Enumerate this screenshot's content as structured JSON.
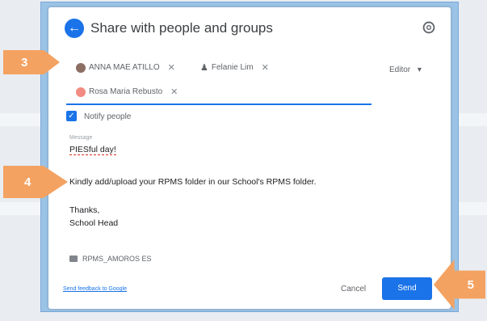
{
  "dialog": {
    "title": "Share with people and groups",
    "back_icon": "arrow-left-icon",
    "settings_icon": "gear-icon"
  },
  "recipients": [
    {
      "name": "ANNA MAE ATILLO",
      "avatar_color": "#8d6e63"
    },
    {
      "name": "Felanie Lim",
      "avatar_color": "#5f6368"
    },
    {
      "name": "Rosa Maria Rebusto",
      "avatar_color": "#f28b82"
    }
  ],
  "role": {
    "label": "Editor",
    "dropdown_icon": "chevron-down-icon"
  },
  "notify": {
    "label": "Notify people",
    "checked": true
  },
  "message": {
    "label": "Message",
    "lines": [
      "PIESful day!",
      "Kindly add/upload your RPMS folder in our School's RPMS folder.",
      "Thanks,",
      "School Head"
    ]
  },
  "attachment": {
    "name": "RPMS_AMOROS ES"
  },
  "footer": {
    "feedback_link": "Send feedback to Google",
    "cancel_label": "Cancel",
    "send_label": "Send"
  },
  "callouts": [
    "3",
    "4",
    "5"
  ],
  "colors": {
    "primary": "#1a73e8",
    "callout": "#f4a261"
  }
}
